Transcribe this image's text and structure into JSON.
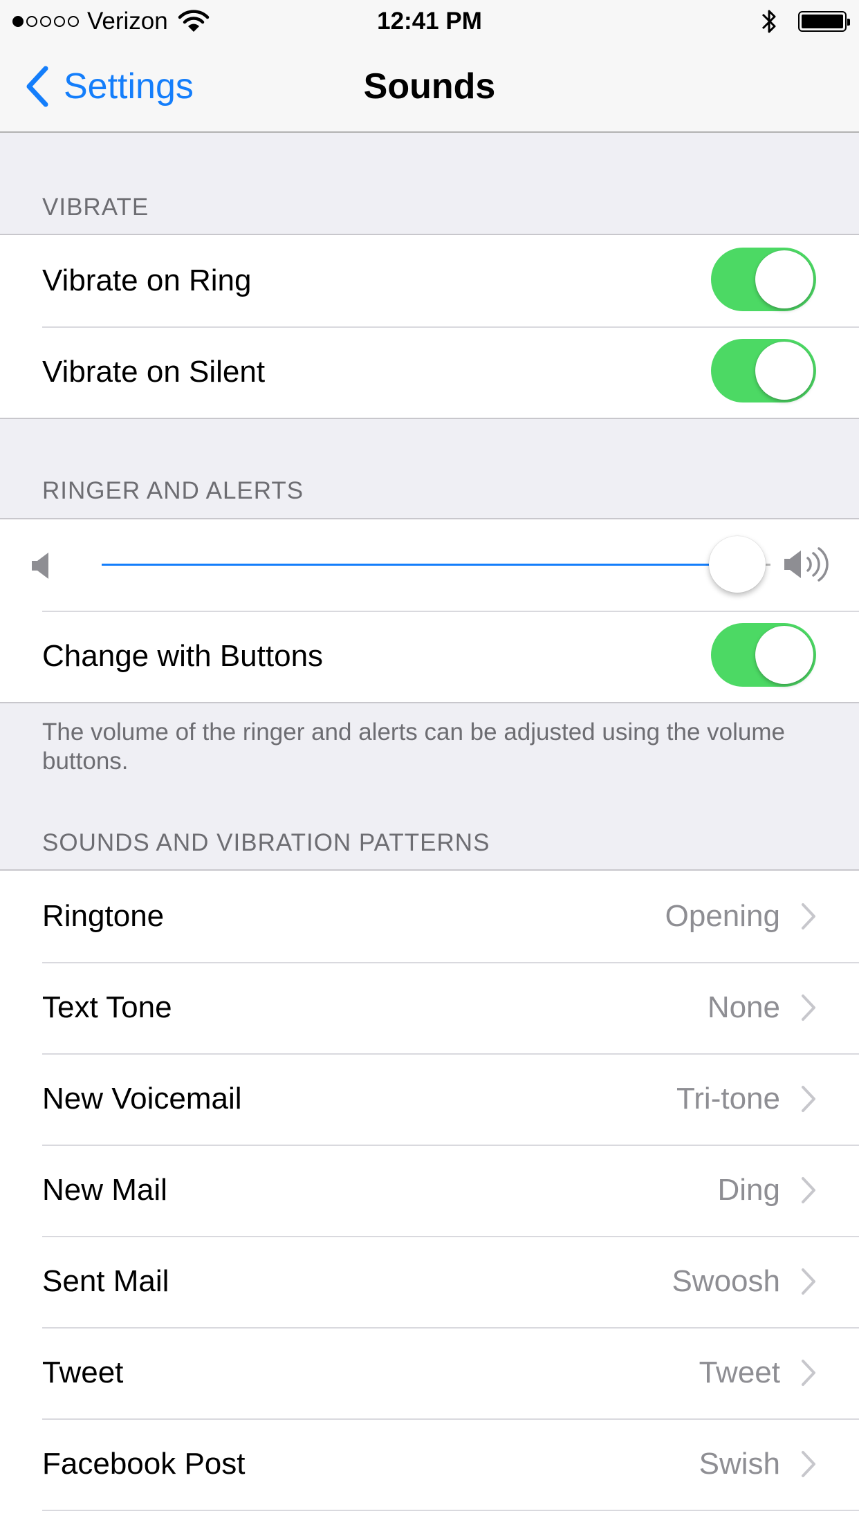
{
  "status_bar": {
    "carrier": "Verizon",
    "signal_bars_filled": 1,
    "signal_bars_total": 5,
    "time": "12:41 PM",
    "battery_level": 1.0
  },
  "nav": {
    "back_label": "Settings",
    "title": "Sounds"
  },
  "vibrate_section": {
    "header": "VIBRATE",
    "rows": [
      {
        "label": "Vibrate on Ring",
        "on": true
      },
      {
        "label": "Vibrate on Silent",
        "on": true
      }
    ]
  },
  "ringer_section": {
    "header": "RINGER AND ALERTS",
    "volume_level": 0.95,
    "change_with_buttons": {
      "label": "Change with Buttons",
      "on": true
    },
    "footer": "The volume of the ringer and alerts can be adjusted using the volume buttons."
  },
  "sounds_section": {
    "header": "SOUNDS AND VIBRATION PATTERNS",
    "rows": [
      {
        "label": "Ringtone",
        "value": "Opening"
      },
      {
        "label": "Text Tone",
        "value": "None"
      },
      {
        "label": "New Voicemail",
        "value": "Tri-tone"
      },
      {
        "label": "New Mail",
        "value": "Ding"
      },
      {
        "label": "Sent Mail",
        "value": "Swoosh"
      },
      {
        "label": "Tweet",
        "value": "Tweet"
      },
      {
        "label": "Facebook Post",
        "value": "Swish"
      }
    ]
  },
  "colors": {
    "accent": "#147efb",
    "toggle_on": "#4cd964",
    "background": "#efeff4",
    "secondary_text": "#8e8e93"
  },
  "icons": {
    "back": "chevron-left-icon",
    "wifi": "wifi-icon",
    "bluetooth": "bluetooth-icon",
    "battery": "battery-icon",
    "volume_low": "speaker-low-icon",
    "volume_high": "speaker-high-icon",
    "row_disclosure": "chevron-right-icon"
  }
}
